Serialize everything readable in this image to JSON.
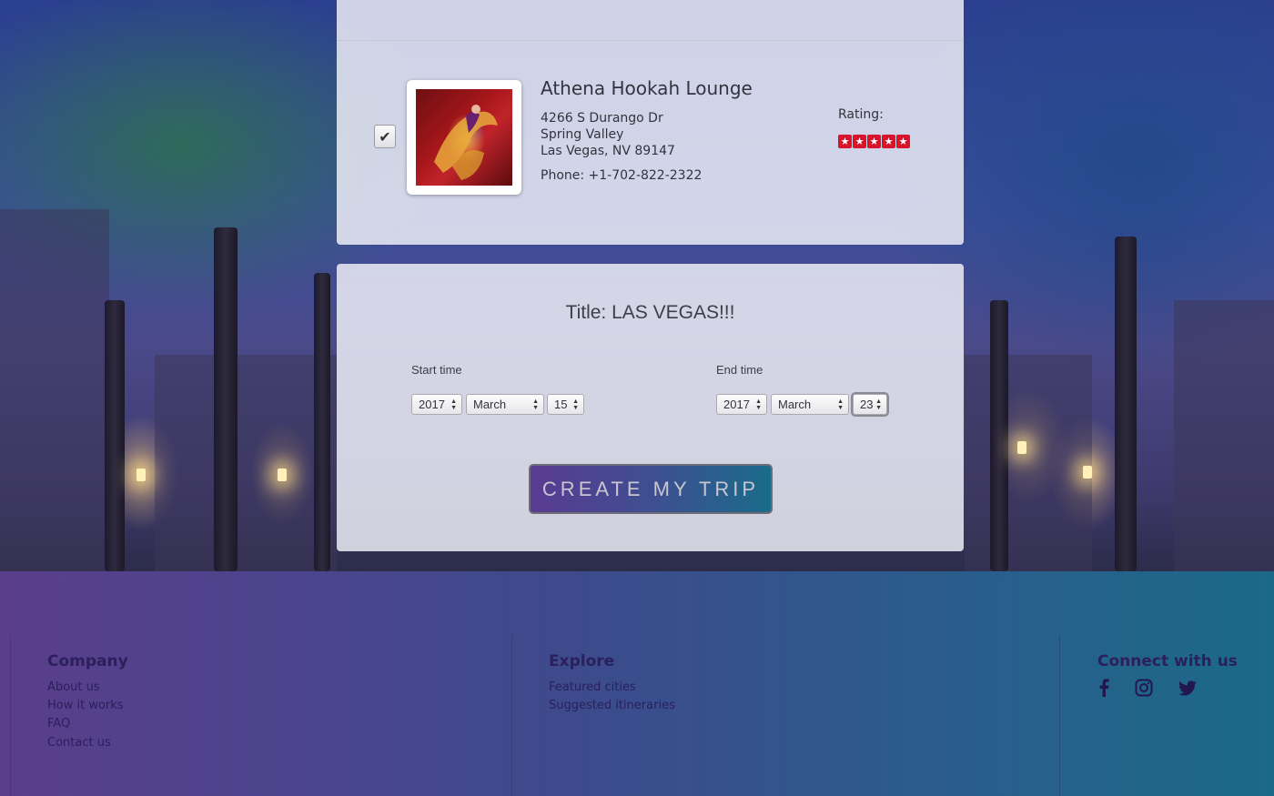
{
  "venue": {
    "name": "Athena Hookah Lounge",
    "address_line1": "4266 S Durango Dr",
    "address_line2": "Spring Valley",
    "address_line3": "Las Vegas, NV 89147",
    "phone": "Phone: +1-702-822-2322",
    "rating_label": "Rating:",
    "rating": 5,
    "rating_max": 5,
    "checkbox_checked": true,
    "star_color": "#d9142a"
  },
  "trip": {
    "title": "Title: LAS VEGAS!!!",
    "start_label": "Start time",
    "end_label": "End time",
    "start": {
      "year": "2017",
      "month": "March",
      "day": "15"
    },
    "end": {
      "year": "2017",
      "month": "March",
      "day": "23"
    },
    "create_button": "CREATE MY TRIP"
  },
  "footer": {
    "company": {
      "heading": "Company",
      "links": [
        "About us",
        "How it works",
        "FAQ",
        "Contact us"
      ]
    },
    "explore": {
      "heading": "Explore",
      "links": [
        "Featured cities",
        "Suggested itineraries"
      ]
    },
    "connect": {
      "heading": "Connect with us",
      "icons": [
        "facebook-icon",
        "instagram-icon",
        "twitter-icon"
      ]
    }
  }
}
